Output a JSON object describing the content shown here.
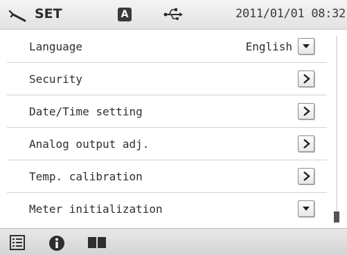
{
  "header": {
    "title": "SET",
    "mode_badge": "A",
    "datetime": "2011/01/01 08:32",
    "icons": [
      "wrench-icon",
      "usb-icon"
    ]
  },
  "menu": {
    "items": [
      {
        "label": "Language",
        "value": "English",
        "control": "dropdown"
      },
      {
        "label": "Security",
        "control": "arrow"
      },
      {
        "label": "Date/Time setting",
        "control": "arrow"
      },
      {
        "label": "Analog output adj.",
        "control": "arrow"
      },
      {
        "label": "Temp. calibration",
        "control": "arrow"
      },
      {
        "label": "Meter initialization",
        "control": "dropdown"
      }
    ]
  },
  "footer": {
    "icons": [
      "list-icon",
      "info-icon",
      "book-icon"
    ]
  },
  "colors": {
    "header_bg": "#e8e8e8",
    "text": "#2e2e2e",
    "divider": "#d2d2d2",
    "footer_bg": "#dcdcdc"
  }
}
